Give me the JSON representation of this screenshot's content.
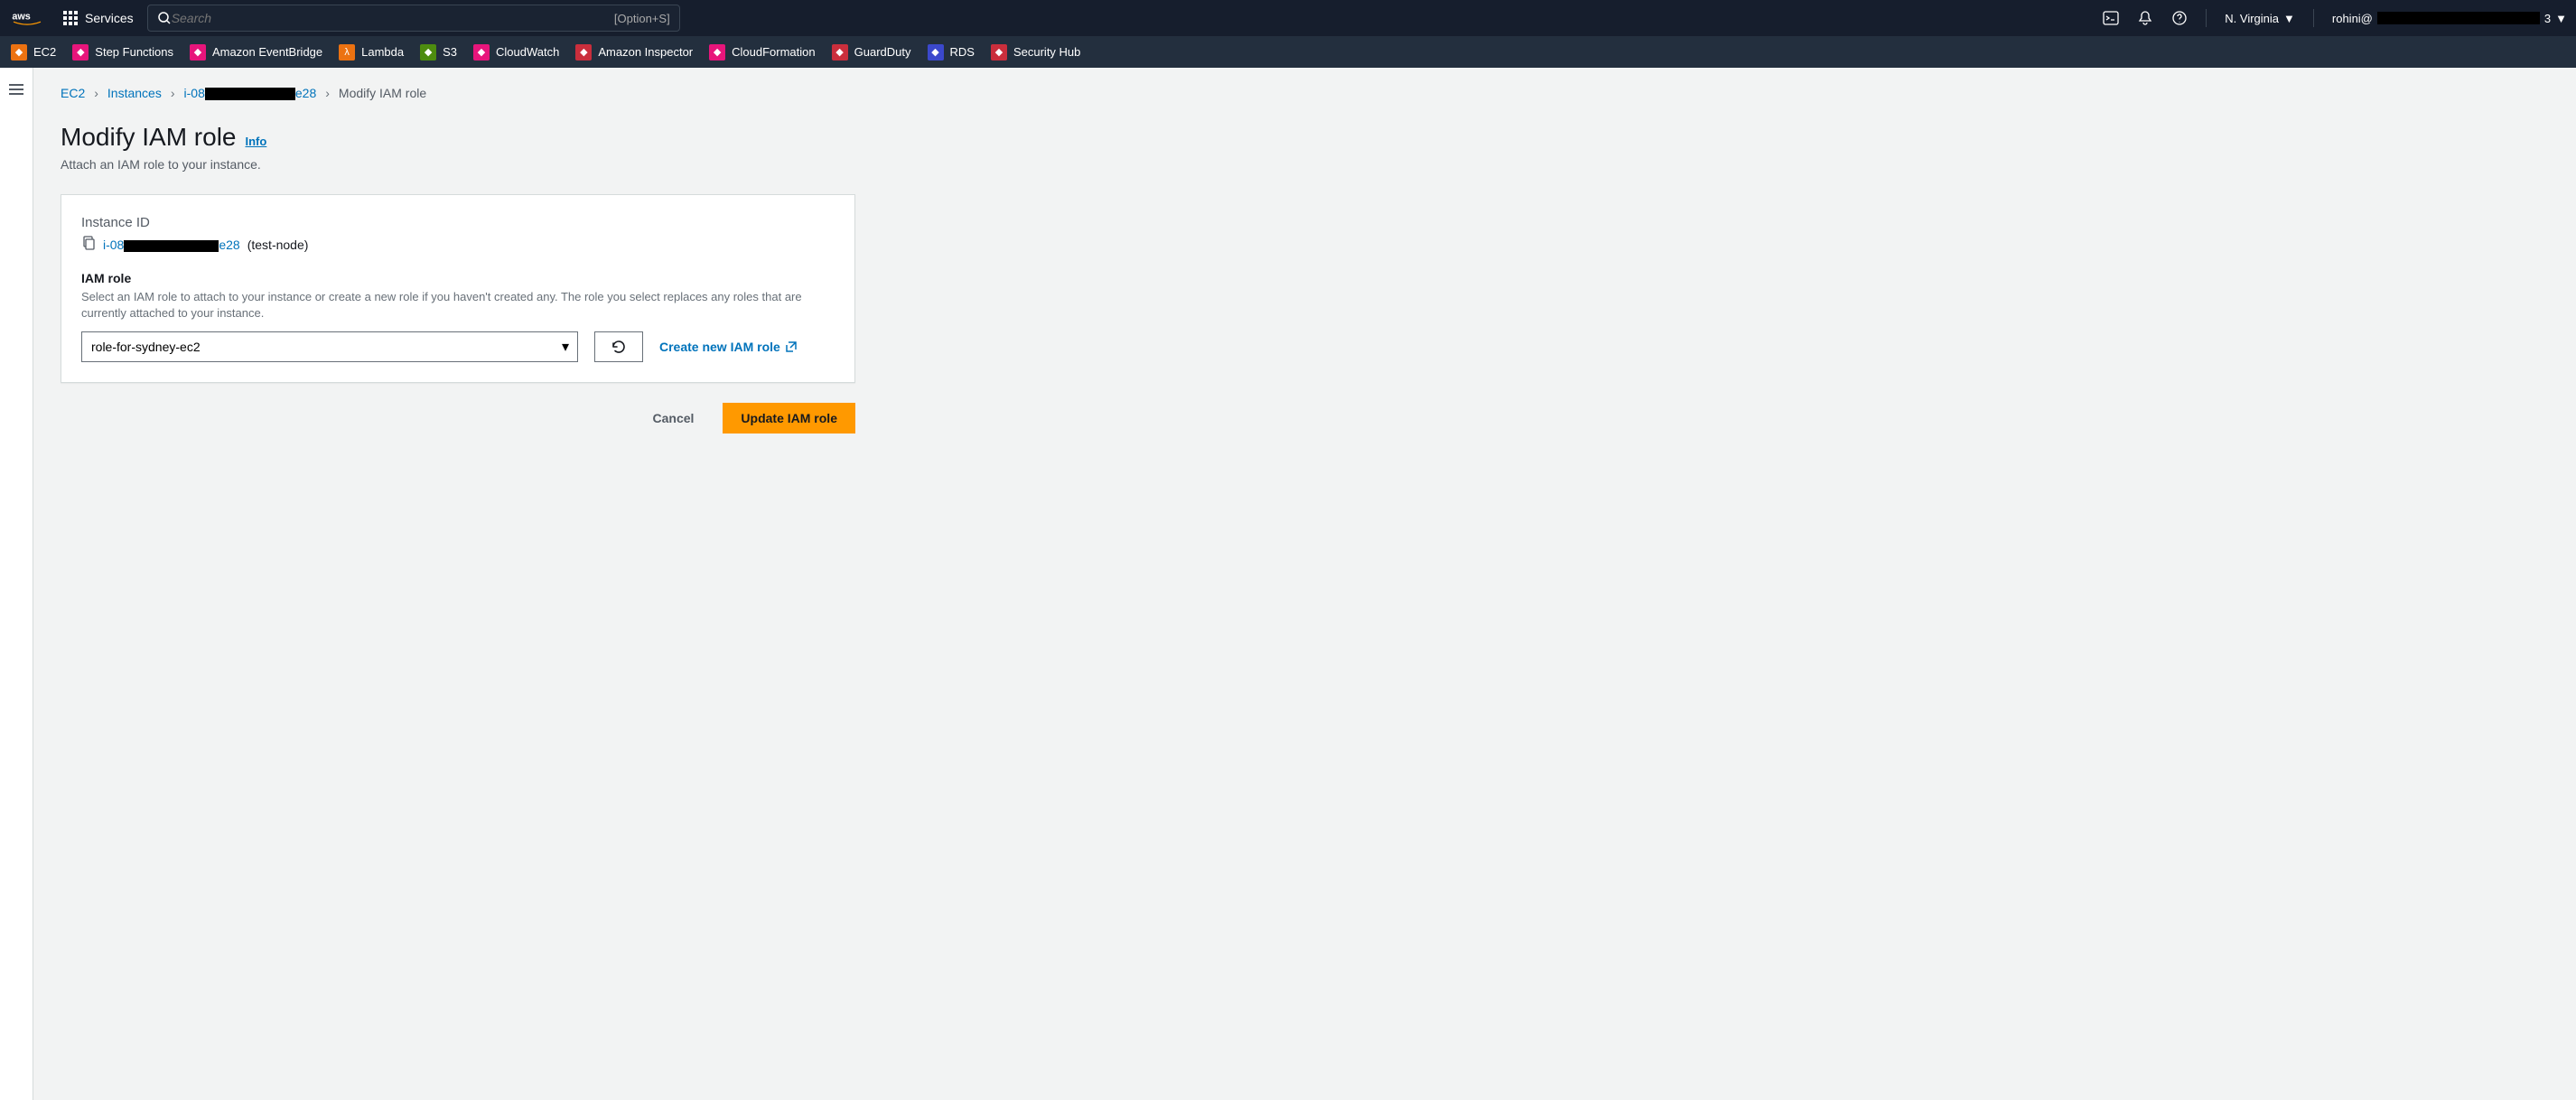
{
  "header": {
    "services_label": "Services",
    "search_placeholder": "Search",
    "search_shortcut": "[Option+S]",
    "region": "N. Virginia",
    "user_prefix": "rohini@",
    "user_suffix": "3"
  },
  "service_shortcuts": [
    {
      "label": "EC2",
      "color": "si-orange"
    },
    {
      "label": "Step Functions",
      "color": "si-pink"
    },
    {
      "label": "Amazon EventBridge",
      "color": "si-pink"
    },
    {
      "label": "Lambda",
      "color": "si-orange"
    },
    {
      "label": "S3",
      "color": "si-green"
    },
    {
      "label": "CloudWatch",
      "color": "si-pink"
    },
    {
      "label": "Amazon Inspector",
      "color": "si-red"
    },
    {
      "label": "CloudFormation",
      "color": "si-pink"
    },
    {
      "label": "GuardDuty",
      "color": "si-red"
    },
    {
      "label": "RDS",
      "color": "si-blue"
    },
    {
      "label": "Security Hub",
      "color": "si-red"
    }
  ],
  "breadcrumbs": {
    "items": [
      "EC2",
      "Instances"
    ],
    "instance_prefix": "i-08",
    "instance_suffix": "e28",
    "current": "Modify IAM role"
  },
  "page": {
    "title": "Modify IAM role",
    "info_label": "Info",
    "description": "Attach an IAM role to your instance."
  },
  "form": {
    "instance_id_label": "Instance ID",
    "instance_id_prefix": "i-08",
    "instance_id_suffix": "e28",
    "instance_name": "(test-node)",
    "iam_role_label": "IAM role",
    "iam_role_help": "Select an IAM role to attach to your instance or create a new role if you haven't created any. The role you select replaces any roles that are currently attached to your instance.",
    "iam_role_selected": "role-for-sydney-ec2",
    "create_link": "Create new IAM role"
  },
  "actions": {
    "cancel": "Cancel",
    "submit": "Update IAM role"
  }
}
